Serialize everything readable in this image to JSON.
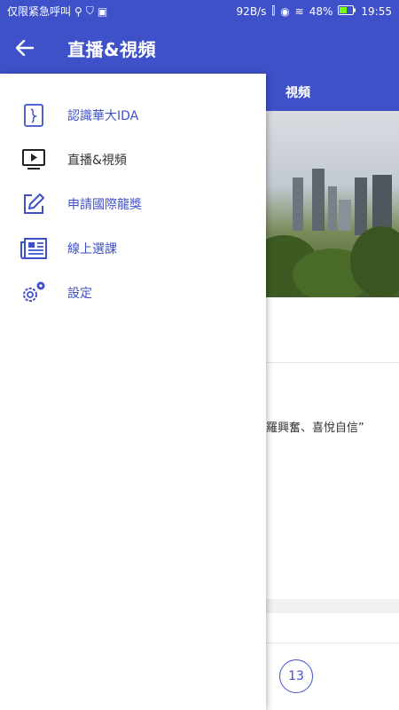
{
  "status": {
    "notification_text": "仅限紧急呼叫",
    "net_speed": "92B/s",
    "battery": "48%",
    "time": "19:55"
  },
  "appbar": {
    "title": "直播&視頻"
  },
  "background": {
    "tab_label": "視頻",
    "quote_text": "羅興奮、喜悅自信”",
    "badge_number": "13"
  },
  "drawer": {
    "items": [
      {
        "label": "認識華大IDA",
        "icon": "ida-logo-icon"
      },
      {
        "label": "直播&視頻",
        "icon": "tv-play-icon"
      },
      {
        "label": "申請國際龍獎",
        "icon": "edit-icon"
      },
      {
        "label": "線上選課",
        "icon": "newspaper-icon"
      },
      {
        "label": "設定",
        "icon": "gears-icon"
      }
    ]
  },
  "colors": {
    "primary": "#3f51c9",
    "active_text": "#333333"
  }
}
